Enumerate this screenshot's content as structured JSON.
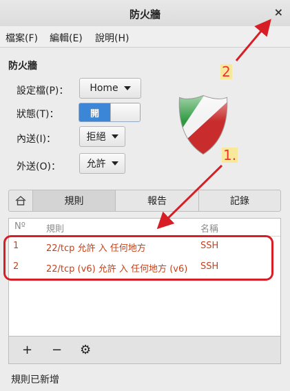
{
  "window": {
    "title": "防火牆",
    "close_glyph": "×"
  },
  "menu": {
    "items": [
      "檔案(F)",
      "編輯(E)",
      "說明(H)"
    ]
  },
  "section": {
    "title": "防火牆"
  },
  "settings": {
    "profile_label": "設定檔(P)：",
    "profile_value": "Home",
    "status_label": "狀態(T)：",
    "status_value": "開",
    "incoming_label": "內送(I)：",
    "incoming_value": "拒絕",
    "outgoing_label": "外送(O)：",
    "outgoing_value": "允許"
  },
  "tabs": {
    "home_icon": "home-icon",
    "rules": "規則",
    "report": "報告",
    "log": "記錄"
  },
  "table": {
    "headers": {
      "num": "Nº",
      "rule": "規則",
      "name": "名稱"
    },
    "rows": [
      {
        "num": "1",
        "rule": "22/tcp 允許 入 任何地方",
        "name": "SSH"
      },
      {
        "num": "2",
        "rule": "22/tcp (v6) 允許 入 任何地方 (v6)",
        "name": "SSH"
      }
    ]
  },
  "toolbar": {
    "add": "+",
    "remove": "−",
    "settings": "⚙"
  },
  "status": {
    "text": "規則已新增"
  },
  "annotations": {
    "one": "1.",
    "two": "2"
  },
  "colors": {
    "accent": "#3b86d6",
    "rule_text": "#c4421a",
    "annotation_red": "#d81e25",
    "annotation_bg": "#f8e89a"
  }
}
